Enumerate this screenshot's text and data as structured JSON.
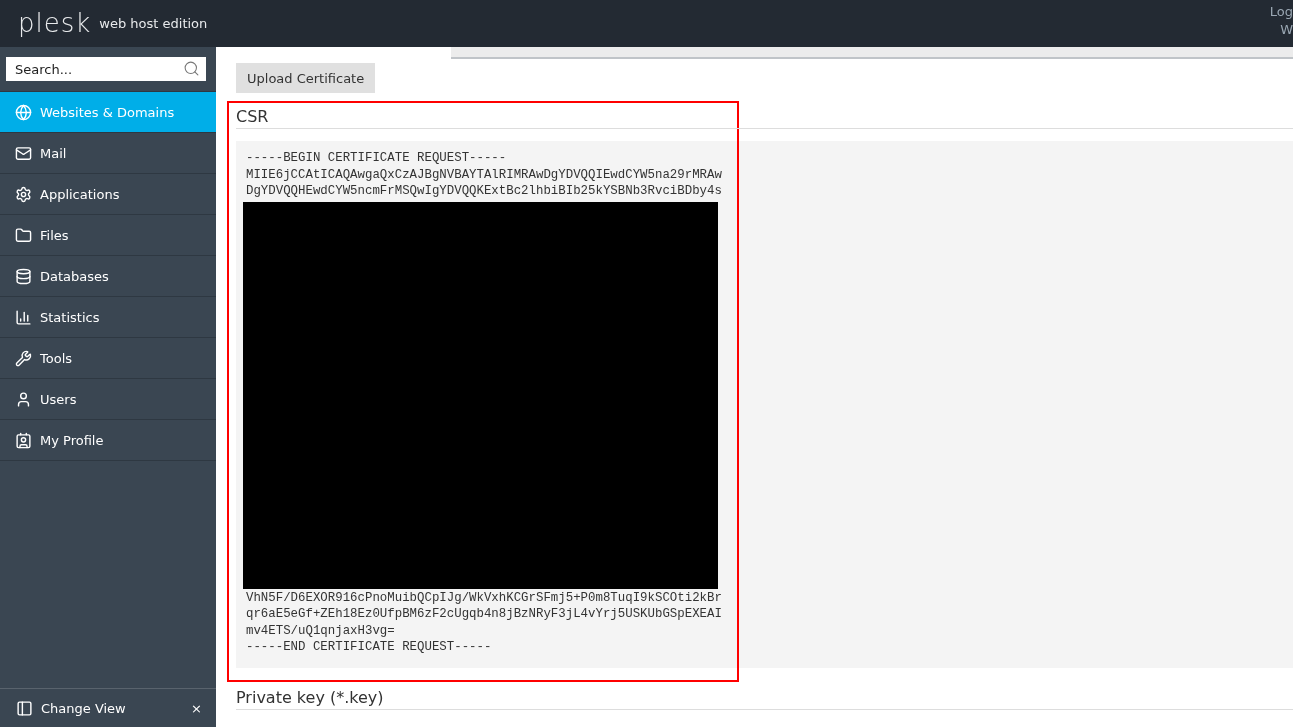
{
  "header": {
    "logo": "plesk",
    "edition": "web host edition",
    "user_links": [
      "Log",
      "W"
    ]
  },
  "sidebar": {
    "search": {
      "placeholder": "Search..."
    },
    "items": [
      {
        "label": "Websites & Domains",
        "kind": "globe",
        "selected": true
      },
      {
        "label": "Mail",
        "kind": "mail",
        "selected": false
      },
      {
        "label": "Applications",
        "kind": "gear",
        "selected": false
      },
      {
        "label": "Files",
        "kind": "folder",
        "selected": false
      },
      {
        "label": "Databases",
        "kind": "database",
        "selected": false
      },
      {
        "label": "Statistics",
        "kind": "chart",
        "selected": false
      },
      {
        "label": "Tools",
        "kind": "tools",
        "selected": false
      },
      {
        "label": "Users",
        "kind": "user",
        "selected": false
      },
      {
        "label": "My Profile",
        "kind": "profile",
        "selected": false
      }
    ],
    "footer": {
      "label": "Change View",
      "close": "×"
    }
  },
  "main": {
    "button": "Upload Certificate",
    "sections": [
      {
        "title": "CSR",
        "highlighted": true,
        "lines_top": [
          "-----BEGIN CERTIFICATE REQUEST-----",
          "MIIE6jCCAtICAQAwgaQxCzAJBgNVBAYTAlRIMRAwDgYDVQQIEwdCYW5na29rMRAw",
          "DgYDVQQHEwdCYW5ncmFrMSQwIgYDVQQKExtBc2lhbiBIb25kYSBNb3RvciBDby4s"
        ],
        "redacted": true,
        "lines_bottom": [
          "VhN5F/D6EXOR916cPnoMuibQCpIJg/WkVxhKCGrSFmj5+P0m8TuqI9kSCOti2kBr",
          "qr6aE5eGf+ZEh18Ez0UfpBM6zF2cUgqb4n8jBzNRyF3jL4vYrj5USKUbGSpEXEAI",
          "mv4ETS/uQ1qnjaxH3vg=",
          "-----END CERTIFICATE REQUEST-----"
        ]
      },
      {
        "title": "Private key (*.key)",
        "highlighted": false
      }
    ]
  }
}
